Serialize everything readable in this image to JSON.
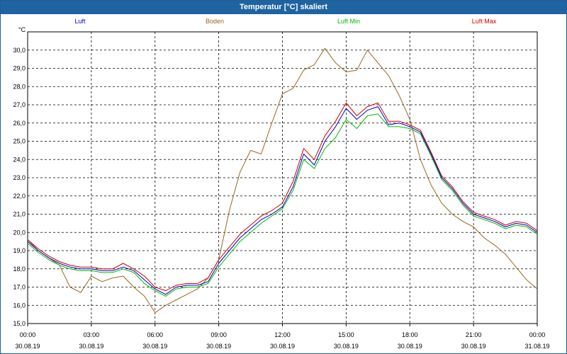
{
  "window": {
    "title": "Temperatur [°C] skaliert"
  },
  "colors": {
    "Luft": "#0000cc",
    "Boden": "#996622",
    "Luft Min": "#00bb00",
    "Luft Max": "#cc0000"
  },
  "chart_data": {
    "type": "line",
    "title": "Temperatur [°C] skaliert",
    "ylabel": "°C",
    "xlabel": "",
    "ylim": [
      15.0,
      31.0
    ],
    "yticks": [
      "15,0",
      "16,0",
      "17,0",
      "18,0",
      "19,0",
      "20,0",
      "21,0",
      "22,0",
      "23,0",
      "24,0",
      "25,0",
      "26,0",
      "27,0",
      "28,0",
      "29,0",
      "30,0"
    ],
    "xlim": [
      0,
      24
    ],
    "xticks": [
      {
        "time": "00:00",
        "date": "30.08.19"
      },
      {
        "time": "03:00",
        "date": "30.08.19"
      },
      {
        "time": "06:00",
        "date": "30.08.19"
      },
      {
        "time": "09:00",
        "date": "30.08.19"
      },
      {
        "time": "12:00",
        "date": "30.08.19"
      },
      {
        "time": "15:00",
        "date": "30.08.19"
      },
      {
        "time": "18:00",
        "date": "30.08.19"
      },
      {
        "time": "21:00",
        "date": "30.08.19"
      },
      {
        "time": "00:00",
        "date": "31.08.19"
      }
    ],
    "grid": true,
    "legend_position": "top",
    "x": [
      0,
      0.5,
      1,
      1.5,
      2,
      2.5,
      3,
      3.5,
      4,
      4.5,
      5,
      5.5,
      6,
      6.5,
      7,
      7.5,
      8,
      8.5,
      9,
      9.5,
      10,
      10.5,
      11,
      11.5,
      12,
      12.5,
      13,
      13.5,
      14,
      14.5,
      15,
      15.5,
      16,
      16.5,
      17,
      17.5,
      18,
      18.5,
      19,
      19.5,
      20,
      20.5,
      21,
      21.5,
      22,
      22.5,
      23,
      23.5,
      24
    ],
    "series": [
      {
        "name": "Luft",
        "values": [
          19.5,
          19.0,
          18.6,
          18.3,
          18.1,
          18.0,
          18.0,
          17.9,
          17.9,
          18.1,
          17.9,
          17.4,
          16.9,
          16.6,
          17.0,
          17.1,
          17.1,
          17.3,
          18.3,
          19.0,
          19.7,
          20.2,
          20.7,
          21.0,
          21.4,
          22.5,
          24.3,
          23.7,
          25.0,
          25.8,
          26.8,
          26.2,
          26.7,
          26.9,
          25.9,
          26.0,
          25.8,
          25.5,
          24.3,
          23.0,
          22.4,
          21.6,
          21.0,
          20.8,
          20.6,
          20.3,
          20.5,
          20.4,
          20.0
        ]
      },
      {
        "name": "Boden",
        "values": [
          19.6,
          19.0,
          18.6,
          18.2,
          17.0,
          16.7,
          17.6,
          17.3,
          17.5,
          17.6,
          17.0,
          16.5,
          15.6,
          16.0,
          16.3,
          16.6,
          16.9,
          17.5,
          18.5,
          21.2,
          23.3,
          24.5,
          24.3,
          26.0,
          27.6,
          27.9,
          28.9,
          29.2,
          30.1,
          29.3,
          28.8,
          28.9,
          30.0,
          29.3,
          28.6,
          27.5,
          26.2,
          24.0,
          22.6,
          21.6,
          21.0,
          20.6,
          20.3,
          19.7,
          19.3,
          18.8,
          18.1,
          17.4,
          16.9
        ]
      },
      {
        "name": "Luft Min",
        "values": [
          19.4,
          18.9,
          18.5,
          18.2,
          18.0,
          17.9,
          17.9,
          17.8,
          17.8,
          18.0,
          17.8,
          17.2,
          16.8,
          16.5,
          16.9,
          17.0,
          17.0,
          17.2,
          18.1,
          18.8,
          19.5,
          20.0,
          20.5,
          20.9,
          21.3,
          22.3,
          24.0,
          23.5,
          24.6,
          25.2,
          26.2,
          25.7,
          26.4,
          26.5,
          25.8,
          25.8,
          25.7,
          25.4,
          24.2,
          22.9,
          22.3,
          21.5,
          20.9,
          20.7,
          20.5,
          20.2,
          20.4,
          20.3,
          19.9
        ]
      },
      {
        "name": "Luft Max",
        "values": [
          19.6,
          19.1,
          18.7,
          18.4,
          18.2,
          18.1,
          18.1,
          18.0,
          18.0,
          18.3,
          18.0,
          17.6,
          17.0,
          16.8,
          17.1,
          17.2,
          17.2,
          17.5,
          18.5,
          19.2,
          19.9,
          20.4,
          20.9,
          21.2,
          21.6,
          22.8,
          24.6,
          24.0,
          25.3,
          26.1,
          27.1,
          26.4,
          26.9,
          27.1,
          26.1,
          26.1,
          25.9,
          25.6,
          24.4,
          23.1,
          22.5,
          21.7,
          21.1,
          20.9,
          20.7,
          20.4,
          20.6,
          20.5,
          20.1
        ]
      }
    ]
  }
}
